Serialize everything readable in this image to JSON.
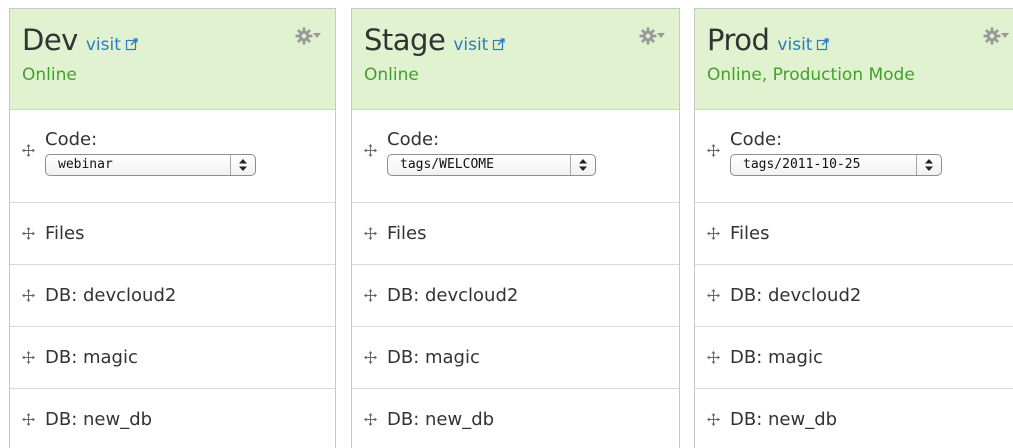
{
  "environments": [
    {
      "name": "Dev",
      "visit_label": "visit",
      "status": "Online",
      "code_label": "Code:",
      "code_value": "webinar",
      "rows": [
        "Files",
        "DB: devcloud2",
        "DB: magic",
        "DB: new_db"
      ]
    },
    {
      "name": "Stage",
      "visit_label": "visit",
      "status": "Online",
      "code_label": "Code:",
      "code_value": "tags/WELCOME",
      "rows": [
        "Files",
        "DB: devcloud2",
        "DB: magic",
        "DB: new_db"
      ]
    },
    {
      "name": "Prod",
      "visit_label": "visit",
      "status": "Online, Production Mode",
      "code_label": "Code:",
      "code_value": "tags/2011-10-25",
      "rows": [
        "Files",
        "DB: devcloud2",
        "DB: magic",
        "DB: new_db"
      ]
    }
  ],
  "colors": {
    "header_bg": "#e0f2cf",
    "status_green": "#43a02a",
    "link_blue": "#2e7bbf",
    "text_dark": "#333333",
    "border": "#d9d9d9"
  },
  "icons": {
    "gear": "gear-icon",
    "external_link": "external-link-icon",
    "move_handle": "move-handle-icon",
    "select_arrows": "select-arrows-icon"
  }
}
